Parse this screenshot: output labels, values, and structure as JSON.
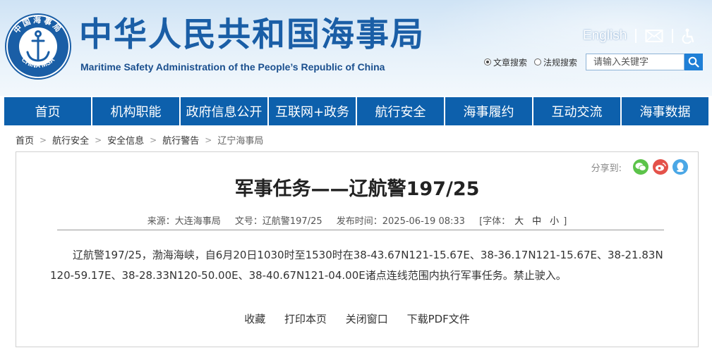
{
  "header": {
    "title": "中华人民共和国海事局",
    "subtitle": "Maritime Safety Administration of the People’s Republic of China",
    "logo_text": {
      "top": "中国海事局",
      "bottom": "CHINA MSA"
    },
    "english_link": "English",
    "search": {
      "options": [
        "文章搜索",
        "法规搜索"
      ],
      "selected": "文章搜索",
      "placeholder": "请输入关键字"
    }
  },
  "nav": {
    "items": [
      "首页",
      "机构职能",
      "政府信息公开",
      "互联网+政务",
      "航行安全",
      "海事履约",
      "互动交流",
      "海事数据"
    ]
  },
  "breadcrumb": [
    "首页",
    "航行安全",
    "安全信息",
    "航行警告",
    "辽宁海事局"
  ],
  "share": {
    "label": "分享到:",
    "icons": [
      "wechat-icon",
      "weibo-icon",
      "qq-icon"
    ]
  },
  "article": {
    "title": "军事任务——辽航警197/25",
    "meta": {
      "source": "来源：大连海事局",
      "doc_no": "文号：辽航警197/25",
      "published": "发布时间：2025-06-19 08:33",
      "font_size_label": "[字体：",
      "font_sizes": [
        "大",
        "中",
        "小"
      ],
      "font_size_close": "]"
    },
    "body": "辽航警197/25，渤海海峡，自6月20日1030时至1530时在38-43.67N121-15.67E、38-36.17N121-15.67E、38-21.83N120-59.17E、38-28.33N120-50.00E、38-40.67N121-04.00E诸点连线范围内执行军事任务。禁止驶入。"
  },
  "actions": [
    "收藏",
    "打印本页",
    "关闭窗口",
    "下载PDF文件"
  ],
  "colors": {
    "brand": "#1a5ea6",
    "nav_bg": "#0d60ac",
    "search_button": "#1f7fd6",
    "wechat": "#5cc34a",
    "weibo": "#e4524a",
    "qq": "#4aa7e6"
  }
}
